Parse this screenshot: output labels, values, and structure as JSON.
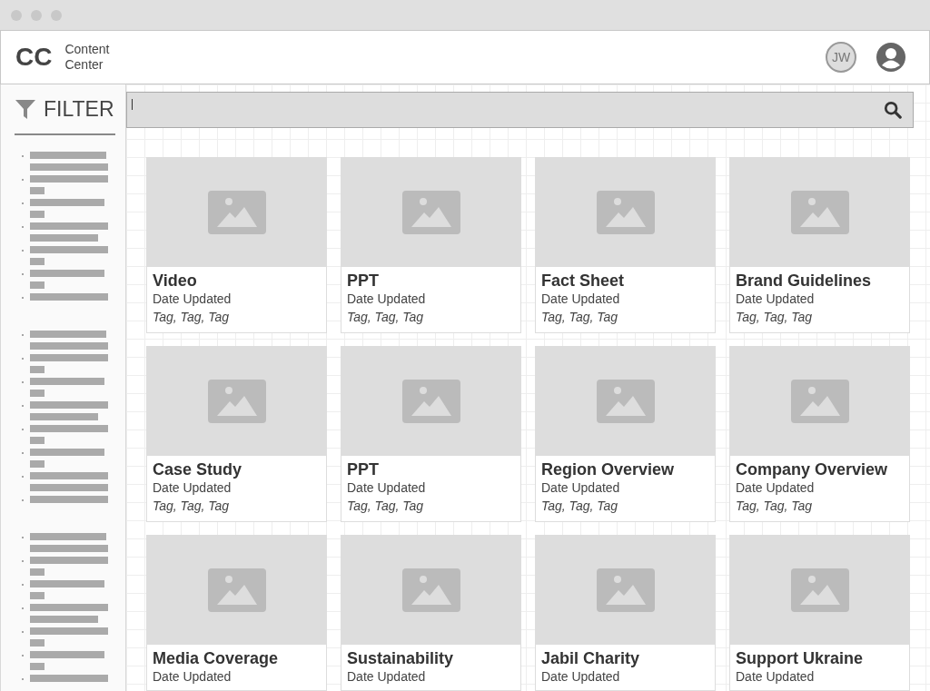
{
  "header": {
    "logo": "CC",
    "app_name": "Content Center",
    "avatar_initials": "JW"
  },
  "sidebar": {
    "title": "FILTER"
  },
  "cards": [
    {
      "title": "Video",
      "date": "Date Updated",
      "tags": "Tag, Tag, Tag"
    },
    {
      "title": "PPT",
      "date": "Date Updated",
      "tags": "Tag, Tag, Tag"
    },
    {
      "title": "Fact Sheet",
      "date": "Date Updated",
      "tags": "Tag, Tag, Tag"
    },
    {
      "title": "Brand Guidelines",
      "date": "Date Updated",
      "tags": "Tag, Tag, Tag"
    },
    {
      "title": "Case Study",
      "date": "Date Updated",
      "tags": "Tag, Tag, Tag"
    },
    {
      "title": "PPT",
      "date": "Date Updated",
      "tags": "Tag, Tag, Tag"
    },
    {
      "title": "Region Overview",
      "date": "Date Updated",
      "tags": "Tag, Tag, Tag"
    },
    {
      "title": "Company Overview",
      "date": "Date Updated",
      "tags": "Tag, Tag, Tag"
    },
    {
      "title": "Media Coverage",
      "date": "Date Updated"
    },
    {
      "title": "Sustainability",
      "date": "Date Updated"
    },
    {
      "title": "Jabil Charity",
      "date": "Date Updated"
    },
    {
      "title": "Support Ukraine",
      "date": "Date Updated"
    }
  ]
}
